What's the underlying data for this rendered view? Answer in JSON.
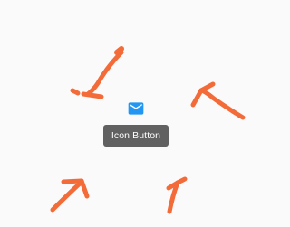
{
  "colors": {
    "background": "#fafafa",
    "icon": "#2196f3",
    "tooltip_background": "#616161",
    "tooltip_text": "#ffffff",
    "annotation_arrows": "#f26b38"
  },
  "icon_button": {
    "icon": "mail-icon"
  },
  "tooltip": {
    "text": "Icon Button"
  }
}
